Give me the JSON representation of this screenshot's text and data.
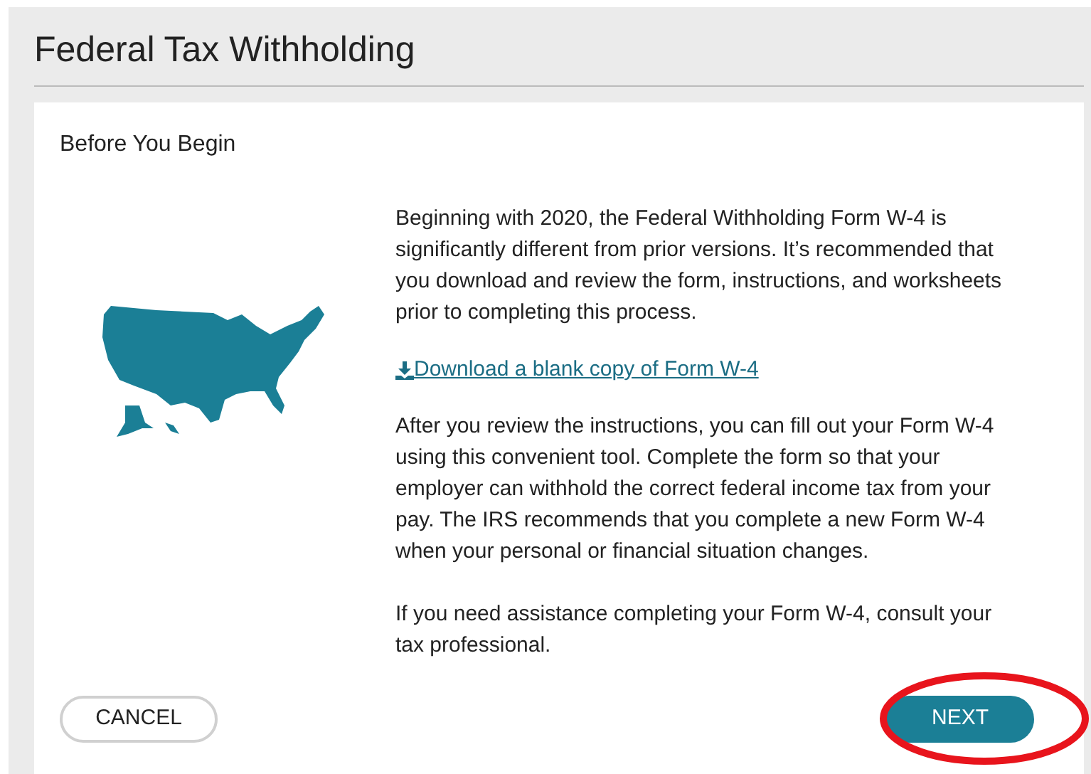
{
  "page": {
    "title": "Federal Tax Withholding"
  },
  "card": {
    "heading": "Before You Begin",
    "paragraphs_before": [
      "Beginning with 2020, the Federal Withholding Form W-4 is significantly different from prior versions. It’s recommended that you download and review the form, instructions, and worksheets prior to completing this process."
    ],
    "download_link": " Download a blank copy of Form W-4",
    "paragraphs_after": [
      "After you review the instructions, you can fill out your Form W-4 using this convenient tool. Complete the form so that your employer can withhold the correct federal income tax from your pay. The IRS recommends that you complete a new Form W-4 when your personal or financial situation changes.",
      "If you need assistance completing your Form W-4, consult your tax professional."
    ]
  },
  "buttons": {
    "cancel": "CANCEL",
    "next": "NEXT"
  }
}
